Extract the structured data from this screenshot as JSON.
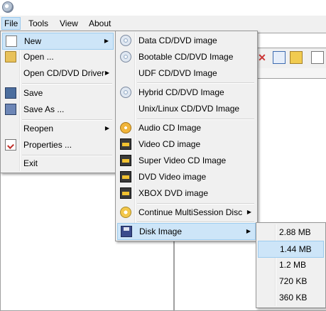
{
  "menubar": {
    "file": "File",
    "tools": "Tools",
    "view": "View",
    "about": "About"
  },
  "file_menu": {
    "new": "New",
    "open": "Open ...",
    "open_driver": "Open CD/DVD Driver",
    "save": "Save",
    "save_as": "Save As ...",
    "reopen": "Reopen",
    "properties": "Properties ...",
    "exit": "Exit"
  },
  "new_menu": {
    "data": "Data CD/DVD image",
    "bootable": "Bootable CD/DVD Image",
    "udf": "UDF CD/DVD Image",
    "hybrid": "Hybrid CD/DVD Image",
    "unix": "Unix/Linux CD/DVD Image",
    "audio": "Audio CD Image",
    "video": "Video CD image",
    "svcd": "Super Video CD Image",
    "dvdvideo": "DVD Video image",
    "xbox": "XBOX DVD image",
    "multisession": "Continue MultiSession Disc",
    "disk": "Disk Image"
  },
  "disk_menu": [
    "2.88 MB",
    "1.44 MB",
    "1.2 MB",
    "720 KB",
    "360 KB"
  ],
  "colors": {
    "highlight": "#cde5f8",
    "highlight_border": "#9ccbee",
    "menu_bg": "#f0f0f0"
  }
}
